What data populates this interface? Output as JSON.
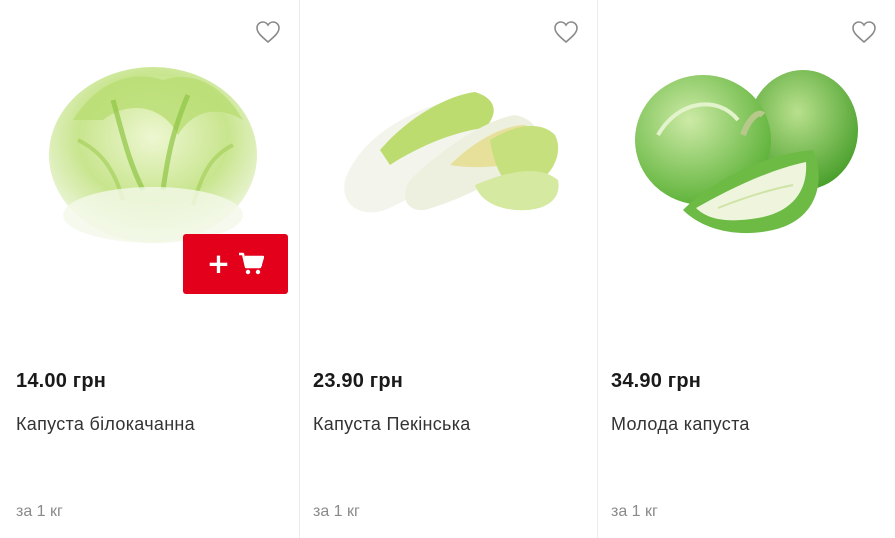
{
  "products": [
    {
      "price": "14.00 грн",
      "name": "Капуста білокачанна",
      "unit": "за 1 кг",
      "image_icon": "white-cabbage-image"
    },
    {
      "price": "23.90 грн",
      "name": "Капуста Пекінська",
      "unit": "за 1 кг",
      "image_icon": "napa-cabbage-image"
    },
    {
      "price": "34.90 грн",
      "name": "Молода капуста",
      "unit": "за 1 кг",
      "image_icon": "young-cabbage-image"
    }
  ],
  "cart_button": {
    "label": "+",
    "icon": "cart-icon",
    "color": "#e3001b"
  },
  "favorite_icon": "heart-icon"
}
